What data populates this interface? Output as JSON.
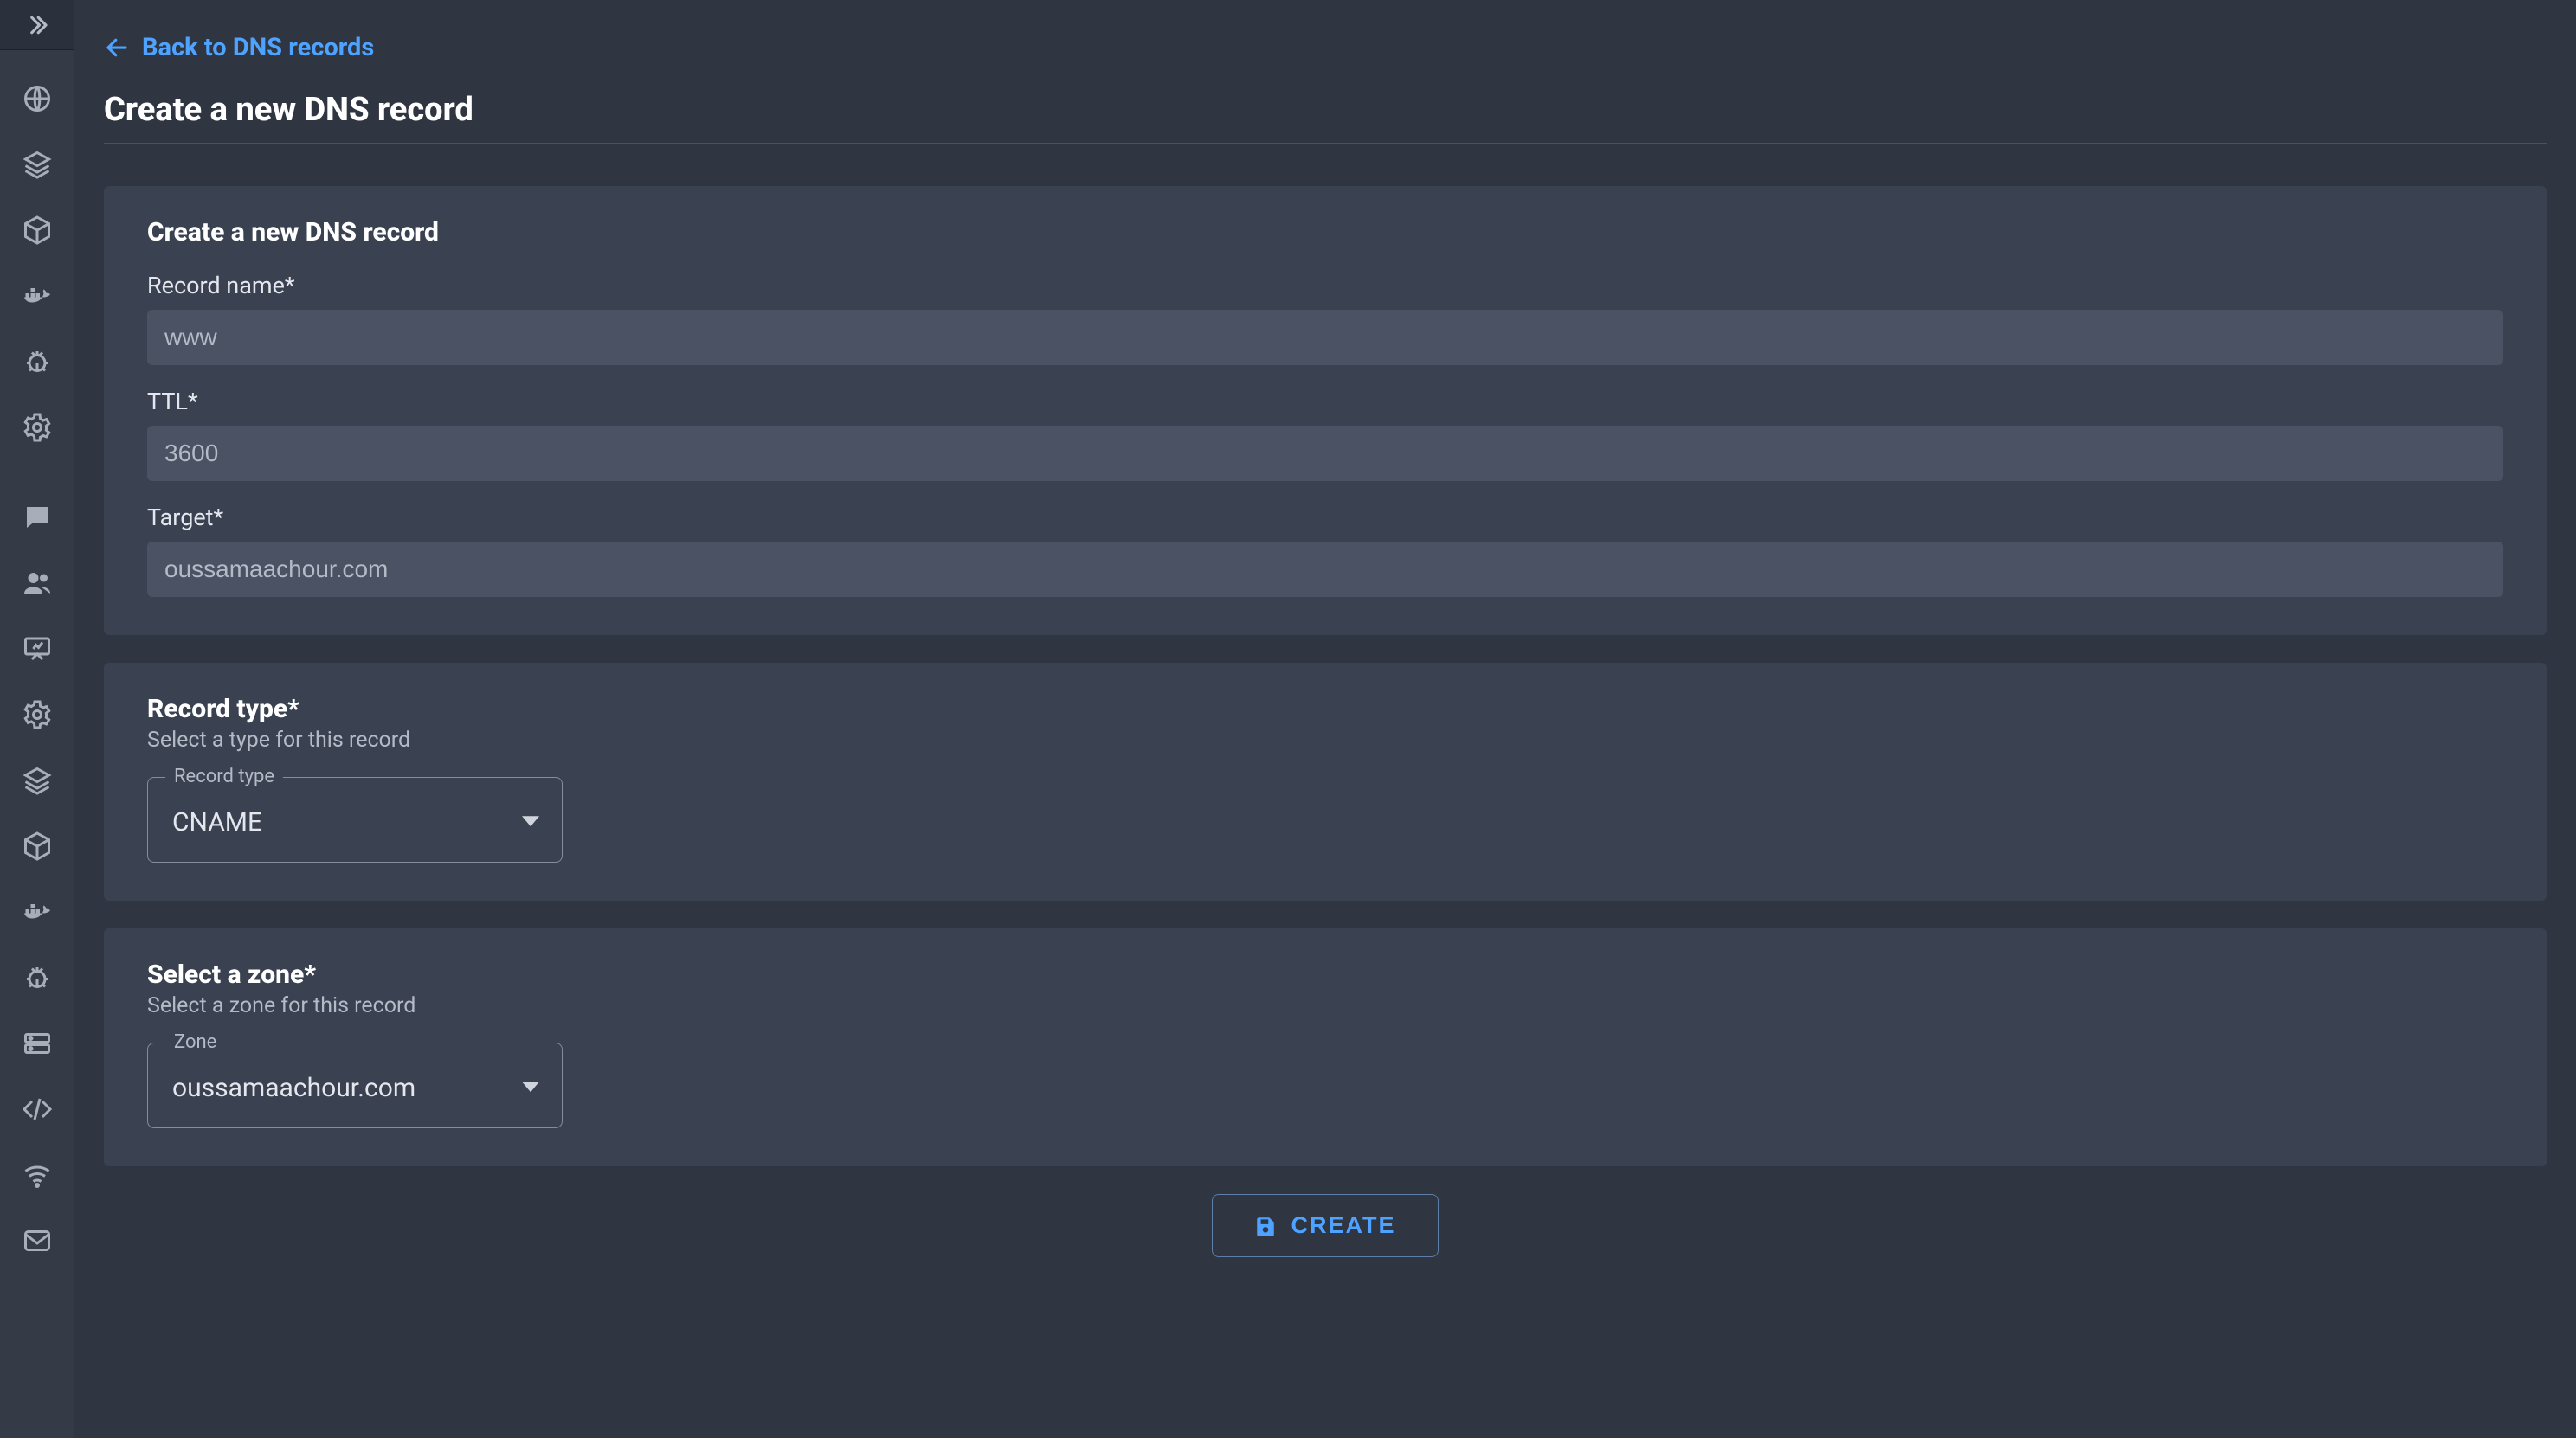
{
  "sidebar": {
    "toggle_name": "collapse-toggle",
    "group1": [
      "globe",
      "layers",
      "cube",
      "docker",
      "bug",
      "gear"
    ],
    "group2": [
      "chat",
      "users",
      "presentation",
      "gear2",
      "layers2",
      "cube2",
      "docker2",
      "bug2",
      "server",
      "code",
      "wifi",
      "mail"
    ]
  },
  "nav": {
    "back_label": "Back to DNS records"
  },
  "page": {
    "title": "Create a new DNS record"
  },
  "card_basic": {
    "title": "Create a new DNS record",
    "record_name_label": "Record name*",
    "record_name_value": "www",
    "ttl_label": "TTL*",
    "ttl_value": "3600",
    "target_label": "Target*",
    "target_value": "oussamaachour.com"
  },
  "card_type": {
    "title": "Record type*",
    "help": "Select a type for this record",
    "float_label": "Record type",
    "value": "CNAME"
  },
  "card_zone": {
    "title": "Select a zone*",
    "help": "Select a zone for this record",
    "float_label": "Zone",
    "value": "oussamaachour.com"
  },
  "actions": {
    "create_label": "CREATE"
  }
}
